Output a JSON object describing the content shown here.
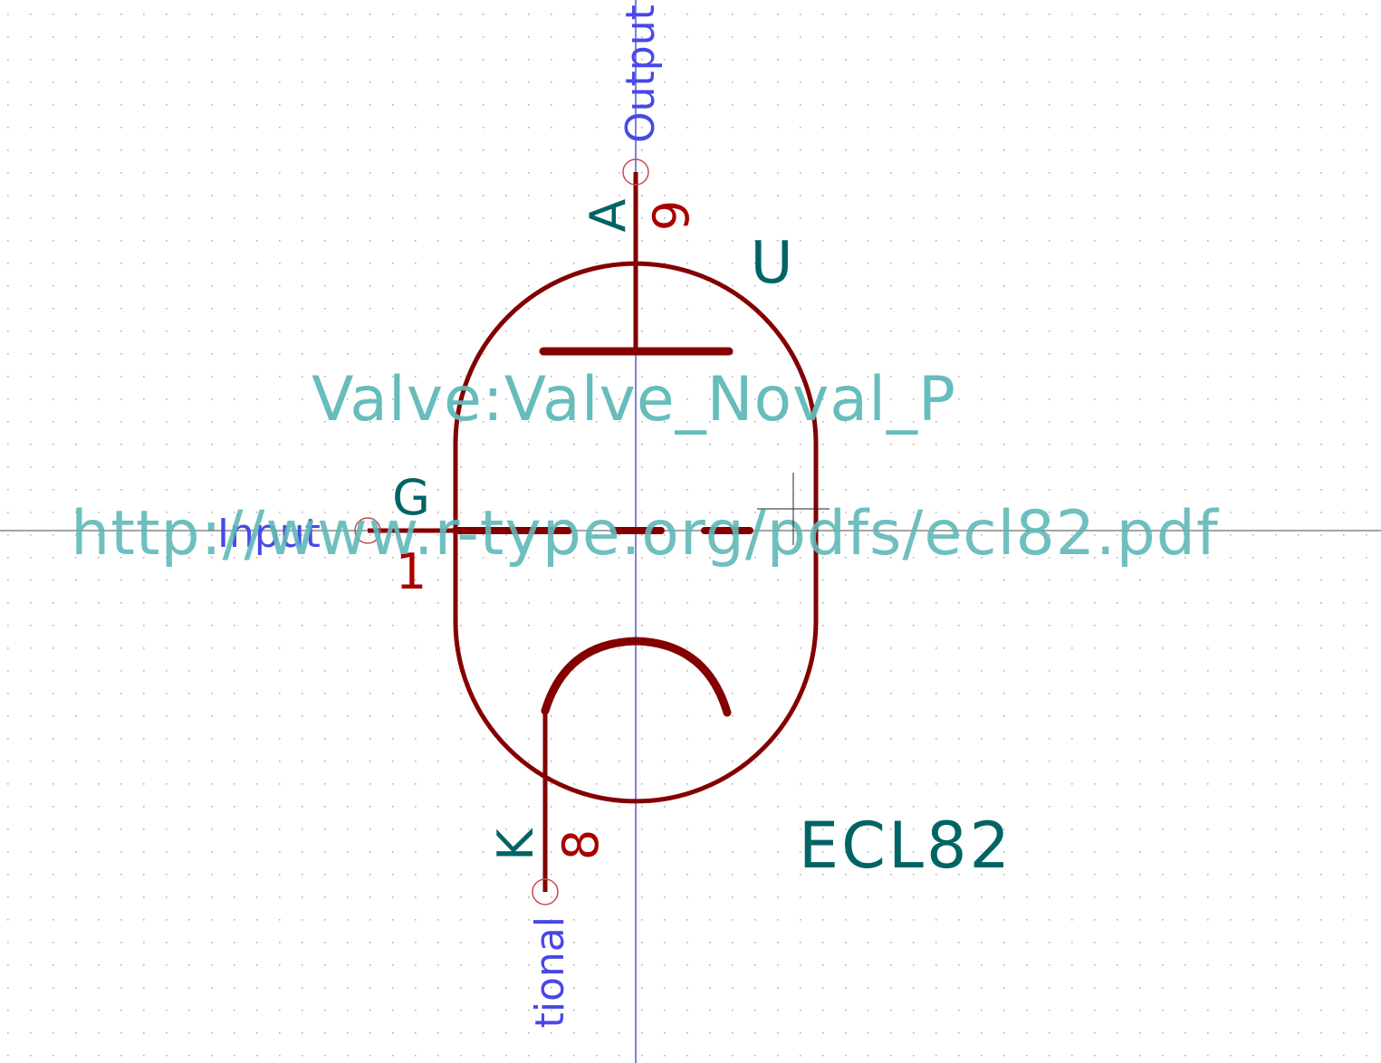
{
  "symbol": {
    "reference": "U",
    "value": "ECL82",
    "footprint": "Valve:Valve_Noval_P",
    "datasheet": "http://www.r-type.org/pdfs/ecl82.pdf"
  },
  "pins": {
    "anode": {
      "name": "A",
      "number": "9",
      "type": "Output"
    },
    "grid": {
      "name": "G",
      "number": "1",
      "type": "Input"
    },
    "cathode": {
      "name": "K",
      "number": "8",
      "type": "tional"
    }
  },
  "colors": {
    "background": "#ffffff",
    "grid_dot": "#b4b4b4",
    "body": "#840000",
    "pin_name": "#006464",
    "pin_number": "#a90000",
    "pin_type": "#4848e8",
    "field": "#5fb8b8",
    "axis": "#0000c8",
    "cursor": "#000000"
  }
}
